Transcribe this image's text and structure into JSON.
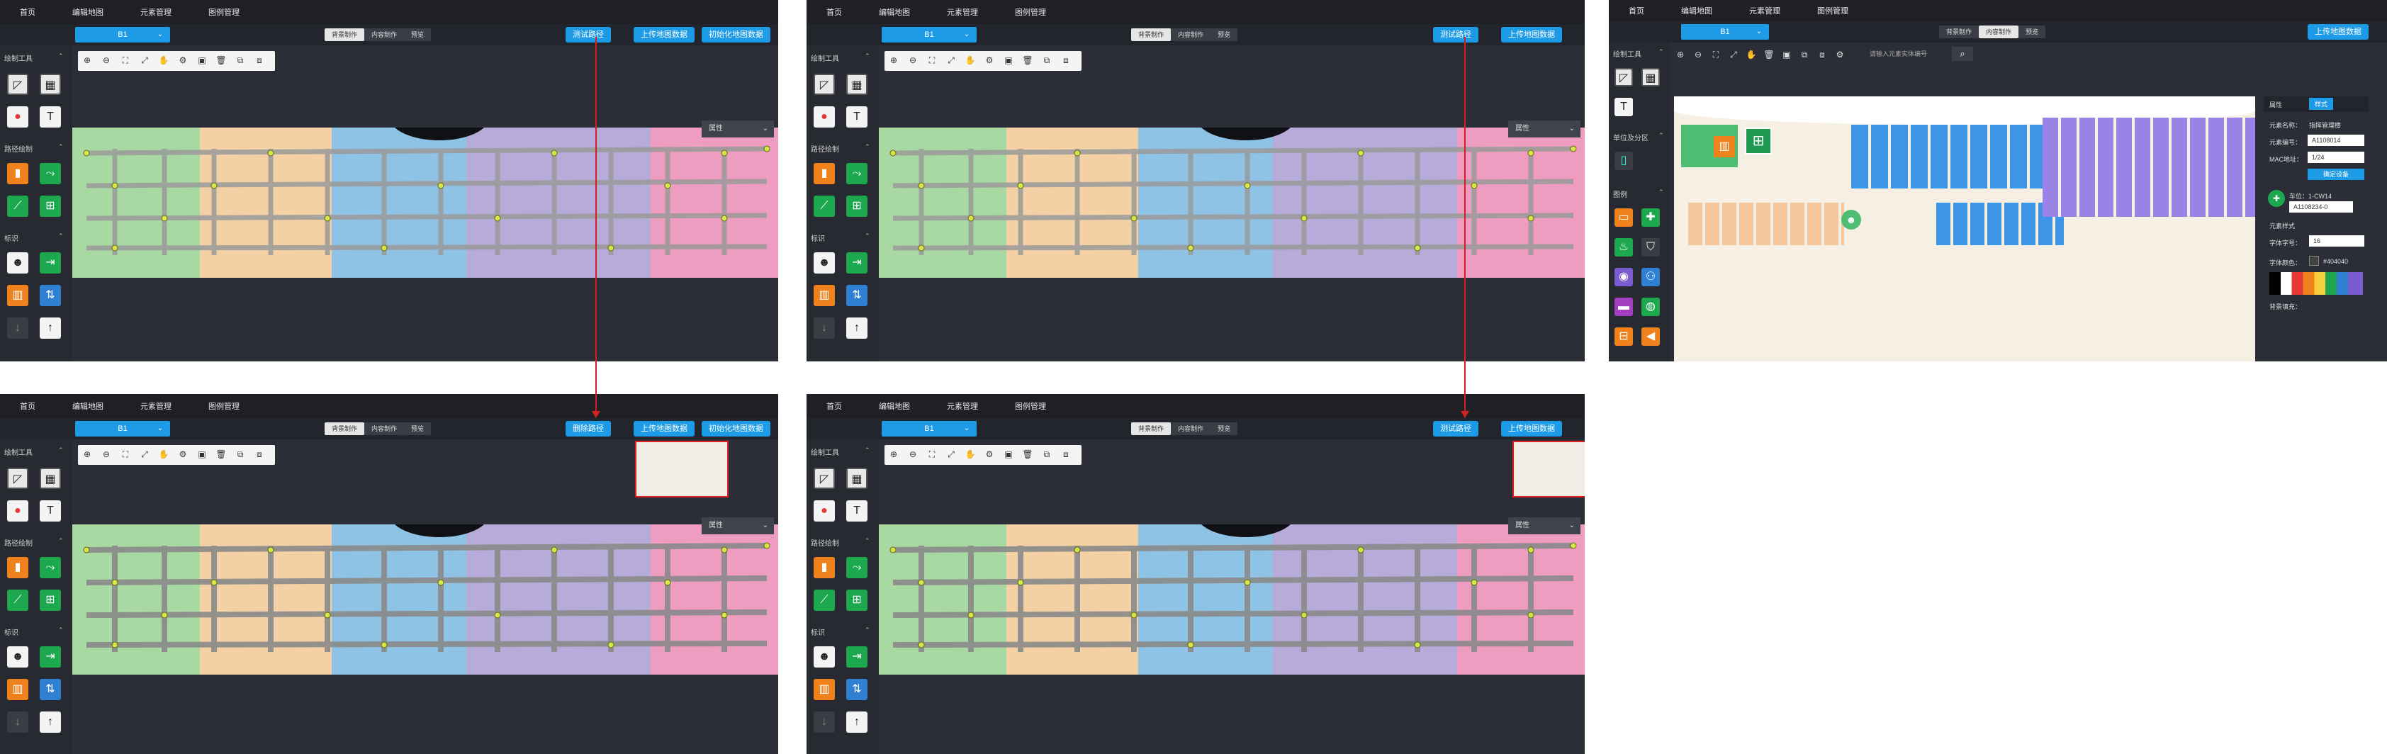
{
  "nav": [
    "首页",
    "编辑地图",
    "元素管理",
    "图例管理"
  ],
  "floor": "B1",
  "mode_tabs": [
    "背景制作",
    "内容制作",
    "预览"
  ],
  "buttons": {
    "test_path": "测试路径",
    "delete_path": "删除路径",
    "upload": "上传地图数据",
    "init": "初始化地图数据"
  },
  "sidebar": {
    "draw_tools": "绘制工具",
    "route_draw": "路径绘制",
    "marker": "标识",
    "position_distribution": "单位及分区",
    "legend": "图例"
  },
  "map": {
    "attr_label": "属性",
    "search_placeholder": "请输入元素实体编号"
  },
  "properties": {
    "tab_attr": "属性",
    "tab_style": "样式",
    "name_label": "元素名称：",
    "name_value": "指挥管理楼",
    "code_label": "元素编号：",
    "code_value": "A1108014",
    "mac_label": "MAC地址：",
    "mac_value": "1/24",
    "confirm_btn": "确定设备",
    "device_label": "车位：1-CW14",
    "device_code": "A1108234-0",
    "style_title": "元素样式",
    "font_size_label": "字体字号：",
    "font_size_value": "16",
    "font_color_label": "字体颜色：",
    "font_color_value": "#404040",
    "bg_label": "背景填充："
  },
  "colors": {
    "accent": "#1e9be6",
    "panel_bg": "#2b2e36",
    "nav_bg": "#1e2026",
    "arrow": "#d62020",
    "zone_green": "#a9d9a3",
    "zone_orange": "#f4d1a4",
    "zone_blue": "#8fc3e6",
    "zone_purple": "#b7acd9",
    "zone_pink": "#ee9cbf"
  }
}
